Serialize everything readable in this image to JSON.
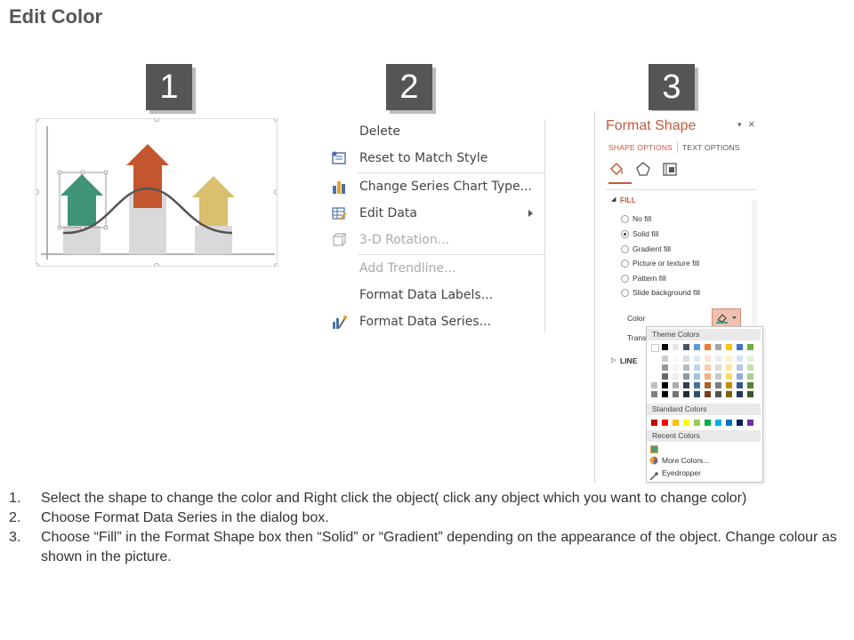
{
  "page": {
    "title": "Edit Color"
  },
  "steps": [
    "1",
    "2",
    "3"
  ],
  "context_menu": {
    "items": [
      {
        "label": "Delete",
        "enabled": true,
        "icon": "none"
      },
      {
        "label": "Reset to Match Style",
        "enabled": true,
        "icon": "reset-style-icon"
      },
      {
        "label": "Change Series Chart Type...",
        "enabled": true,
        "icon": "chart-type-icon"
      },
      {
        "label": "Edit Data",
        "enabled": true,
        "icon": "edit-data-icon",
        "submenu": true
      },
      {
        "label": "3-D Rotation...",
        "enabled": false,
        "icon": "3d-rotation-icon"
      },
      {
        "label": "Add Trendline...",
        "enabled": false,
        "icon": "none"
      },
      {
        "label": "Format Data Labels...",
        "enabled": true,
        "icon": "none"
      },
      {
        "label": "Format Data Series...",
        "enabled": true,
        "icon": "format-series-icon"
      }
    ]
  },
  "format_pane": {
    "title": "Format Shape",
    "tabs": [
      "SHAPE OPTIONS",
      "TEXT OPTIONS"
    ],
    "fill_section": "FILL",
    "fill_options": [
      "No fill",
      "Solid fill",
      "Gradient fill",
      "Picture or texture fill",
      "Pattern fill",
      "Slide background fill"
    ],
    "selected_fill": "Solid fill",
    "color_label": "Color",
    "transparency_label": "Trans",
    "line_section": "LINE",
    "palette": {
      "theme_header": "Theme Colors",
      "standard_header": "Standard Colors",
      "recent_header": "Recent Colors",
      "more_colors": "More Colors...",
      "eyedropper": "Eyedropper",
      "theme_top": [
        "#ffffff",
        "#000000",
        "#e7e6e6",
        "#44546a",
        "#5b9bd5",
        "#ed7d31",
        "#a5a5a5",
        "#ffc000",
        "#4472c4",
        "#70ad47"
      ],
      "standard": [
        "#c00000",
        "#ff0000",
        "#ffc000",
        "#ffff00",
        "#92d050",
        "#00b050",
        "#00b0f0",
        "#0070c0",
        "#002060",
        "#7030a0"
      ],
      "recent": [
        "#4a9a7a"
      ]
    }
  },
  "instructions": [
    {
      "num": "1.",
      "text": "Select the shape to change the color and Right click the object( click any object which you want to change color)"
    },
    {
      "num": "2.",
      "text": "Choose Format Data Series in the dialog box."
    },
    {
      "num": "3.",
      "text": "Choose “Fill” in the Format Shape box then “Solid” or “Gradient” depending on the appearance of the object. Change colour as shown in the picture."
    }
  ],
  "colors": {
    "arrow_green": "#3f9379",
    "arrow_orange": "#c4562f",
    "arrow_gold": "#d9bf6e",
    "bar_gray": "#d9d9d9",
    "accent": "#c55a3c"
  }
}
